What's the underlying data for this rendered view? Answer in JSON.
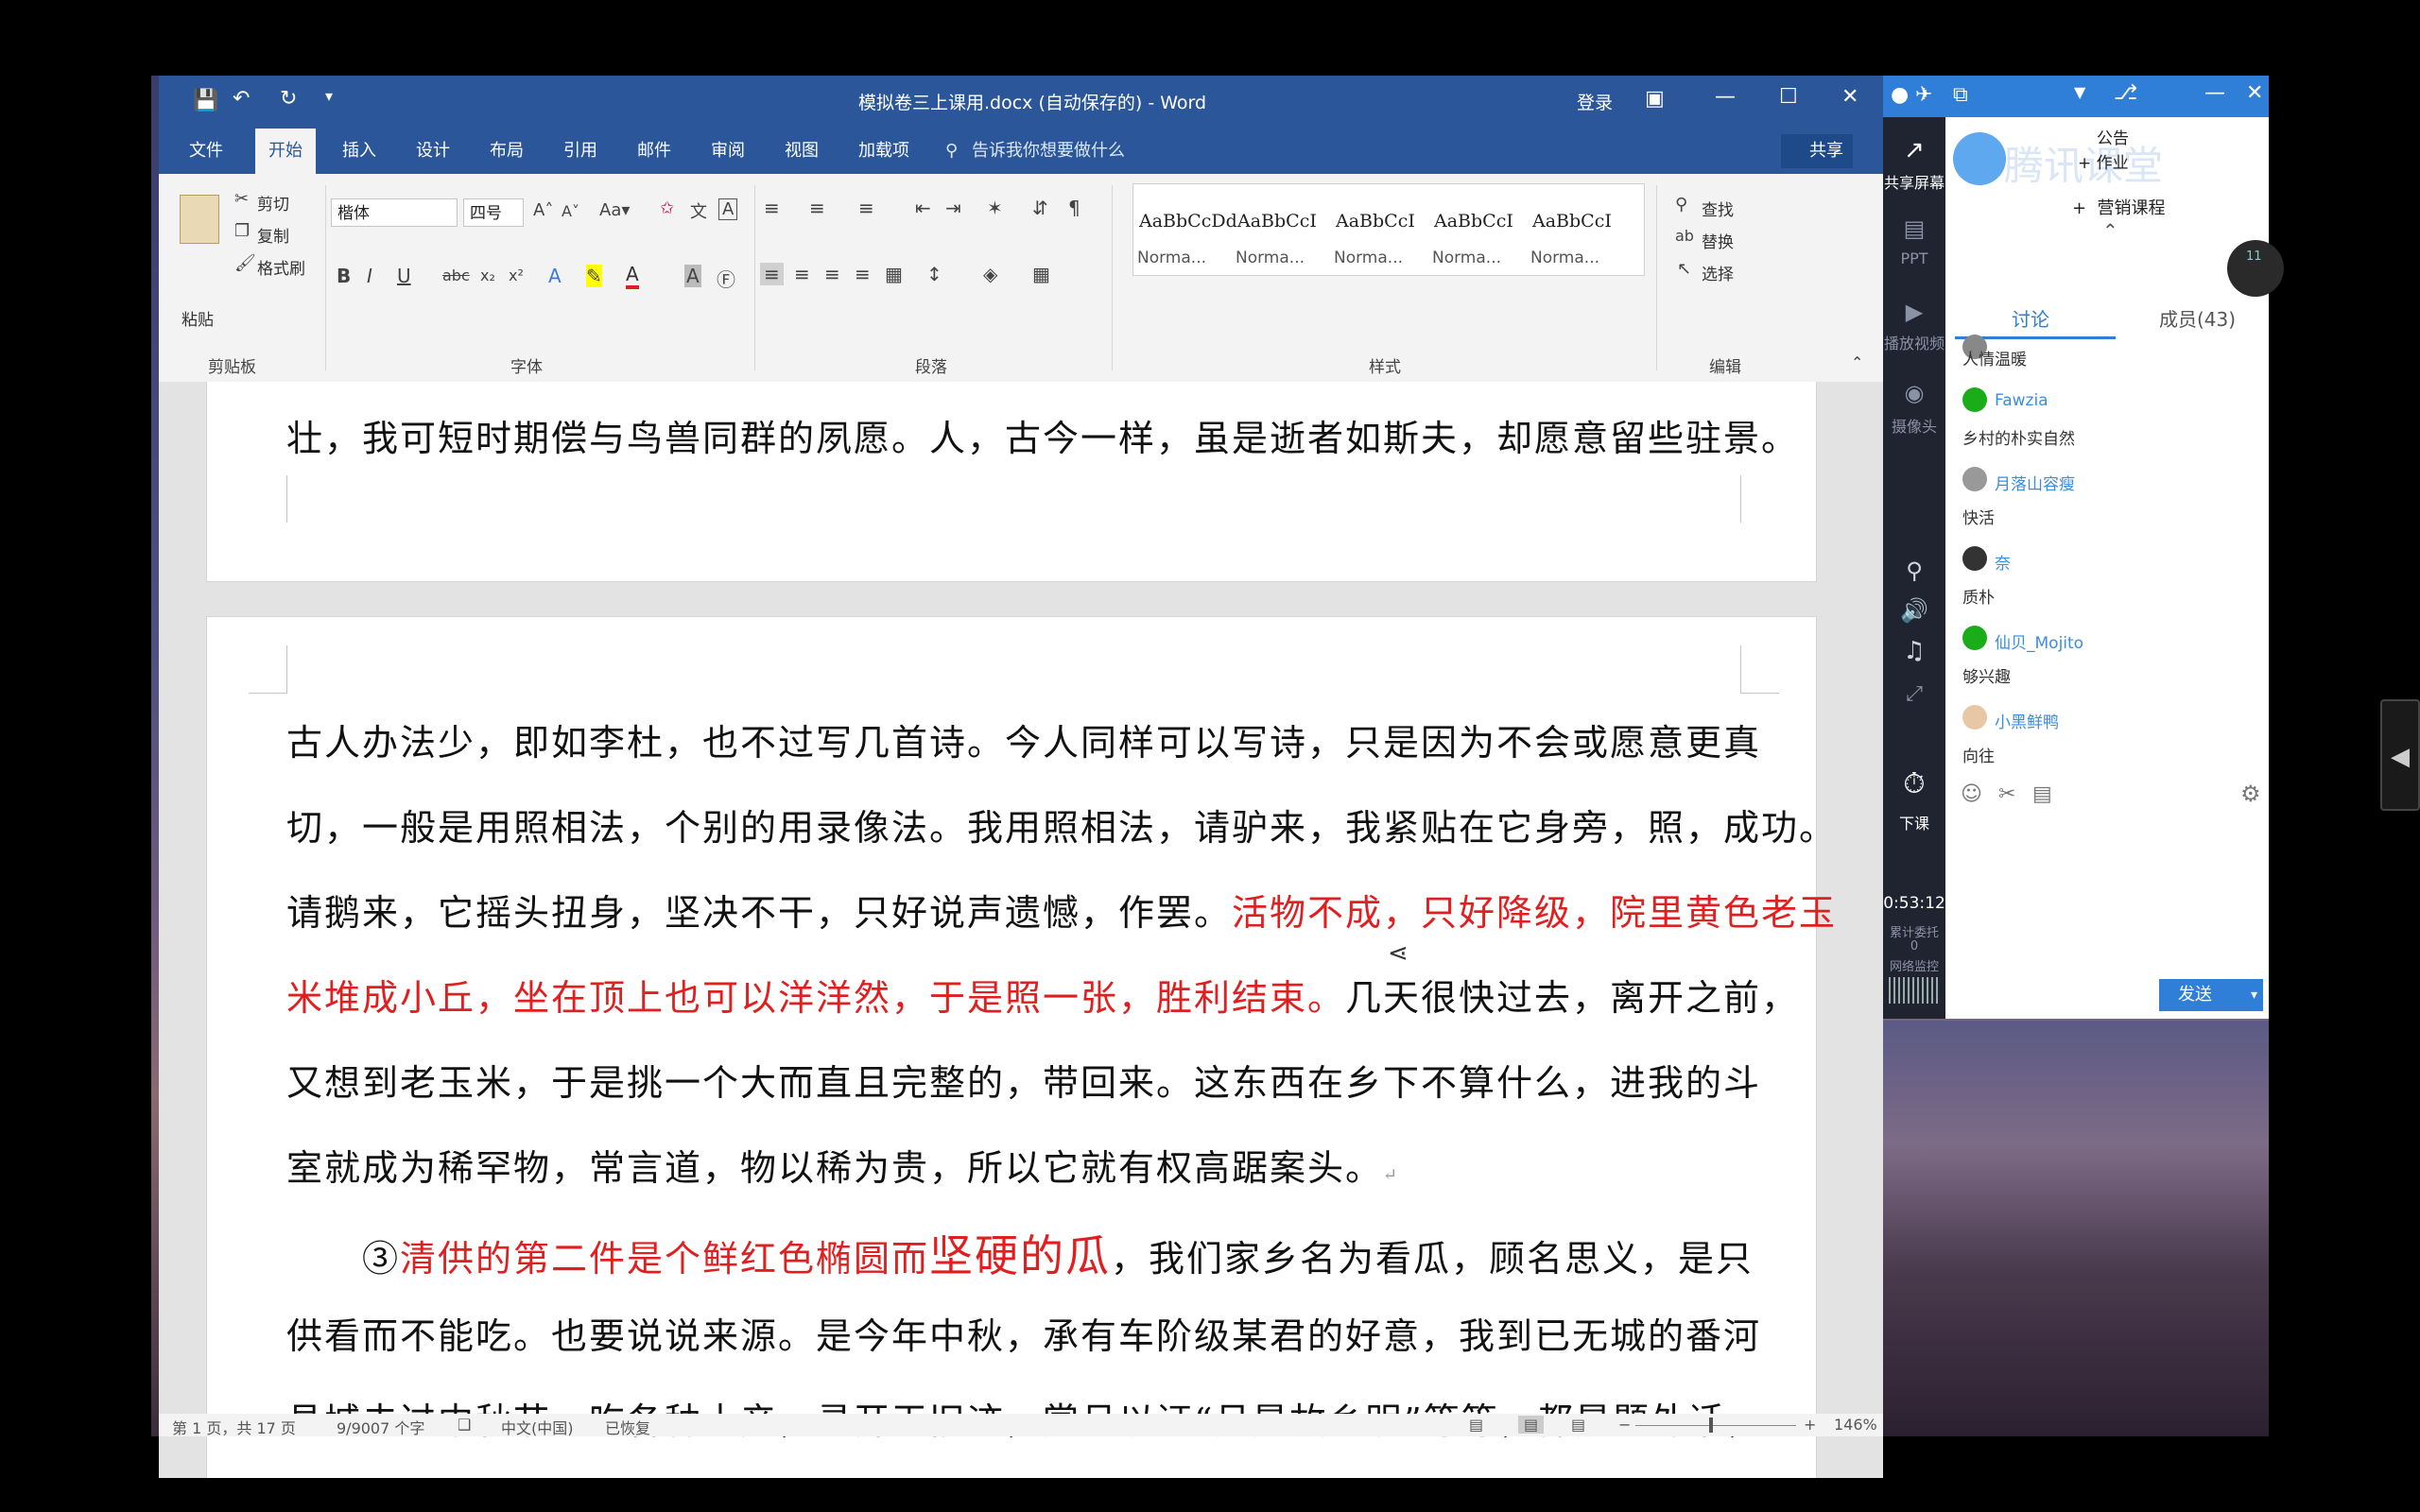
{
  "word": {
    "title": "模拟卷三上课用.docx (自动保存的) - Word",
    "signin": "登录",
    "tabs": [
      "文件",
      "开始",
      "插入",
      "设计",
      "布局",
      "引用",
      "邮件",
      "审阅",
      "视图",
      "加载项"
    ],
    "tell_me": "告诉我你想要做什么",
    "share": "共享",
    "clipboard": {
      "paste": "粘贴",
      "cut": "剪切",
      "copy": "复制",
      "format_painter": "格式刷",
      "label": "剪贴板"
    },
    "font": {
      "name": "楷体",
      "size": "四号",
      "label": "字体"
    },
    "paragraph_label": "段落",
    "styles": {
      "label": "样式",
      "items": [
        {
          "preview": "AaBbCcDd",
          "name": "Norma..."
        },
        {
          "preview": "AaBbCcI",
          "name": "Norma..."
        },
        {
          "preview": "AaBbCcI",
          "name": "Norma..."
        },
        {
          "preview": "AaBbCcI",
          "name": "Norma..."
        },
        {
          "preview": "AaBbCcI",
          "name": "Norma..."
        }
      ]
    },
    "editing": {
      "find": "查找",
      "replace": "替换",
      "select": "选择",
      "label": "编辑"
    },
    "doc": {
      "page1_last": "壮，我可短时期偿与鸟兽同群的夙愿。人，古今一样，虽是逝者如斯夫，却愿意留些驻景。",
      "p1_l1": "古人办法少，即如李杜，也不过写几首诗。今人同样可以写诗，只是因为不会或愿意更真",
      "p1_l2": "切，一般是用照相法，个别的用录像法。我用照相法，请驴来，我紧贴在它身旁，照，成功。",
      "p1_l3a": "请鹅来，它摇头扭身，坚决不干，只好说声遗憾，作罢。",
      "p1_l3b": "活物不成，只好降级，院里黄色老玉",
      "p1_l4a": "米堆成小丘，坐在顶上也可以洋洋然，于是照一张，胜利结束。",
      "p1_l4b": "几天很快过去，离开之前，",
      "p1_l5": "又想到老玉米，于是挑一个大而直且完整的，带回来。这东西在乡下不算什么，进我的斗",
      "p1_l6": "室就成为稀罕物，常言道，物以稀为贵，所以它就有权高踞案头。",
      "p2_num": "③",
      "p2_red1": "清供的第二件是个鲜红色椭圆而",
      "p2_red2": "坚硬的瓜",
      "p2_l1b": "，我们家乡名为看瓜，顾名思义，是只",
      "p2_l2": "供看而不能吃。也要说说来源。是今年中秋，承有车阶级某君的好意，我到已无城的番河",
      "p2_l3": "县城去过中秋节。吃各种土产，寻开天旧迹，赏月以证“月是故乡明”等等，都是题外话，"
    },
    "status": {
      "page": "第 1 页，共 17 页",
      "words": "9/9007 个字",
      "lang": "中文(中国)",
      "recovered": "已恢复",
      "zoom": "146%"
    }
  },
  "tencent": {
    "brand": "腾讯课堂",
    "notice": "公告",
    "homework": "作业",
    "marketing": "营销课程",
    "tab_discuss": "讨论",
    "tab_members": "成员(43)",
    "badge": "11",
    "sidebar": [
      "共享屏幕",
      "PPT",
      "播放视频",
      "摄像头",
      "下课"
    ],
    "timer": "0:53:12",
    "timer_sub1": "累计委托",
    "timer_sub2": "0",
    "timer_sub3": "网络监控",
    "messages": [
      {
        "name": "",
        "text": "人情温暖",
        "avatar": "#888"
      },
      {
        "name": "Fawzia",
        "text": "乡村的朴实自然",
        "avatar": "#1aad19"
      },
      {
        "name": "月落山容瘦",
        "text": "快活",
        "avatar": "#999"
      },
      {
        "name": "奈",
        "text": "质朴",
        "avatar": "#333"
      },
      {
        "name": "仙贝_Mojito",
        "text": "够兴趣",
        "avatar": "#1aad19"
      },
      {
        "name": "小黑鲜鸭",
        "text": "向往",
        "avatar": "#e8c7a6"
      }
    ],
    "send": "发送"
  },
  "colors": {
    "word_blue": "#2b579a",
    "red_text": "#e02020",
    "tx_blue": "#2f7fd8"
  }
}
